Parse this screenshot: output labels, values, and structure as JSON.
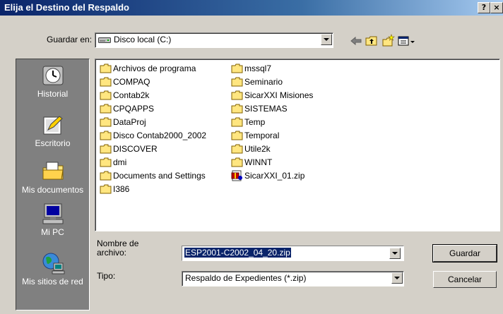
{
  "window": {
    "title": "Elija el Destino del Respaldo",
    "help_button": "?",
    "close_button": "×"
  },
  "toolbar": {
    "save_in_label": "Guardar en:",
    "save_in_value": "Disco local (C:)"
  },
  "places": [
    {
      "label": "Historial",
      "icon": "history-icon"
    },
    {
      "label": "Escritorio",
      "icon": "desktop-icon"
    },
    {
      "label": "Mis documentos",
      "icon": "my-documents-icon"
    },
    {
      "label": "Mi PC",
      "icon": "my-computer-icon"
    },
    {
      "label": "Mis sitios de red",
      "icon": "network-places-icon"
    }
  ],
  "files": {
    "column1": [
      "Archivos de programa",
      "COMPAQ",
      "Contab2k",
      "CPQAPPS",
      "DataProj",
      "Disco Contab2000_2002",
      "DISCOVER",
      "dmi",
      "Documents and Settings",
      "I386"
    ],
    "column2": [
      "mssql7",
      "Seminario",
      "SicarXXI Misiones",
      "SISTEMAS",
      "Temp",
      "Temporal",
      "Utile2k",
      "WINNT"
    ],
    "zipfile": "SicarXXI_01.zip"
  },
  "form": {
    "filename_label": "Nombre de\narchivo:",
    "filename_label_line1": "Nombre de",
    "filename_label_line2": "archivo:",
    "filename_value": "ESP2001-C2002_04_20.zip",
    "type_label": "Tipo:",
    "type_value": "Respaldo de Expedientes (*.zip)"
  },
  "buttons": {
    "save": "Guardar",
    "cancel": "Cancelar"
  },
  "colors": {
    "titlebar_start": "#0a246a",
    "titlebar_end": "#a6caf0",
    "face": "#d4d0c8",
    "selection": "#0a246a",
    "folder": "#ffe680"
  }
}
